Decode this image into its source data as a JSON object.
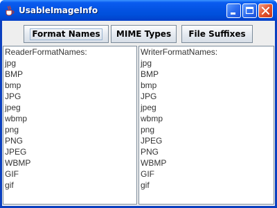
{
  "window": {
    "title": "UsableImageInfo"
  },
  "toolbar": {
    "format_names_label": "Format Names",
    "mime_types_label": "MIME Types",
    "file_suffixes_label": "File Suffixes"
  },
  "reader_list": {
    "lines": [
      "ReaderFormatNames:",
      "jpg",
      "BMP",
      "bmp",
      "JPG",
      "jpeg",
      "wbmp",
      "png",
      "PNG",
      "JPEG",
      "WBMP",
      "GIF",
      "gif"
    ]
  },
  "writer_list": {
    "lines": [
      "WriterFormatNames:",
      "jpg",
      "BMP",
      "bmp",
      "JPG",
      "jpeg",
      "wbmp",
      "png",
      "JPEG",
      "PNG",
      "WBMP",
      "GIF",
      "gif"
    ]
  }
}
